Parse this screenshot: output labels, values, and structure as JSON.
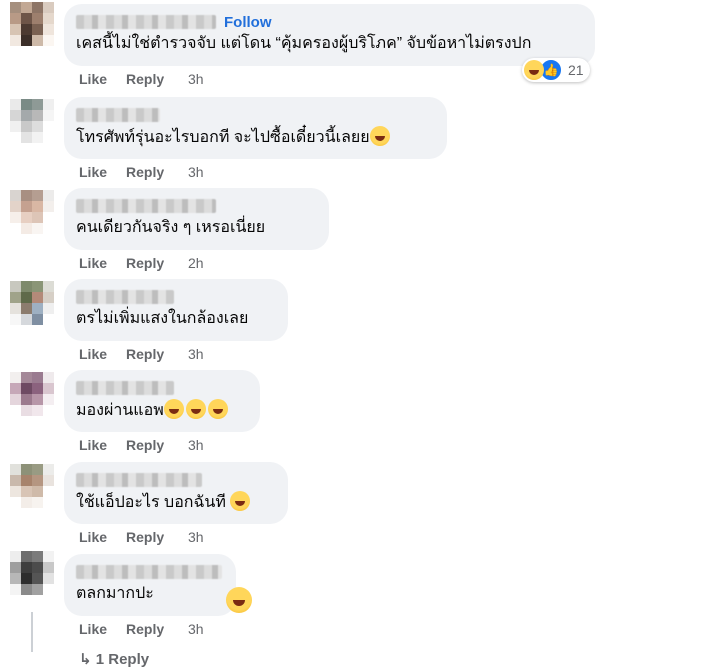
{
  "follow_label": "Follow",
  "actions": {
    "like": "Like",
    "reply": "Reply"
  },
  "comments": [
    {
      "text": "เคสนี้ไม่ใช่ตำรวจจับ แต่โดน “คุ้มครองผู้บริโภค” จับข้อหาไม่ตรงปก",
      "time": "3h",
      "reaction_count": "21"
    },
    {
      "text": "โทรศัพท์รุ่นอะไรบอกที จะไปซื้อเดี๋ยวนี้เลยย",
      "time": "3h"
    },
    {
      "text": "คนเดียวกันจริง ๆ เหรอเนี่ยย",
      "time": "2h"
    },
    {
      "text": "ตรไม่เพิ่มแสงในกล้องเลย",
      "time": "3h"
    },
    {
      "text": "มองผ่านแอพ",
      "time": "3h"
    },
    {
      "text": "ใช้แอ็ปอะไร บอกฉันที",
      "time": "3h"
    },
    {
      "text": "ตลกมากปะ",
      "time": "3h"
    }
  ],
  "more_replies": "1 Reply"
}
